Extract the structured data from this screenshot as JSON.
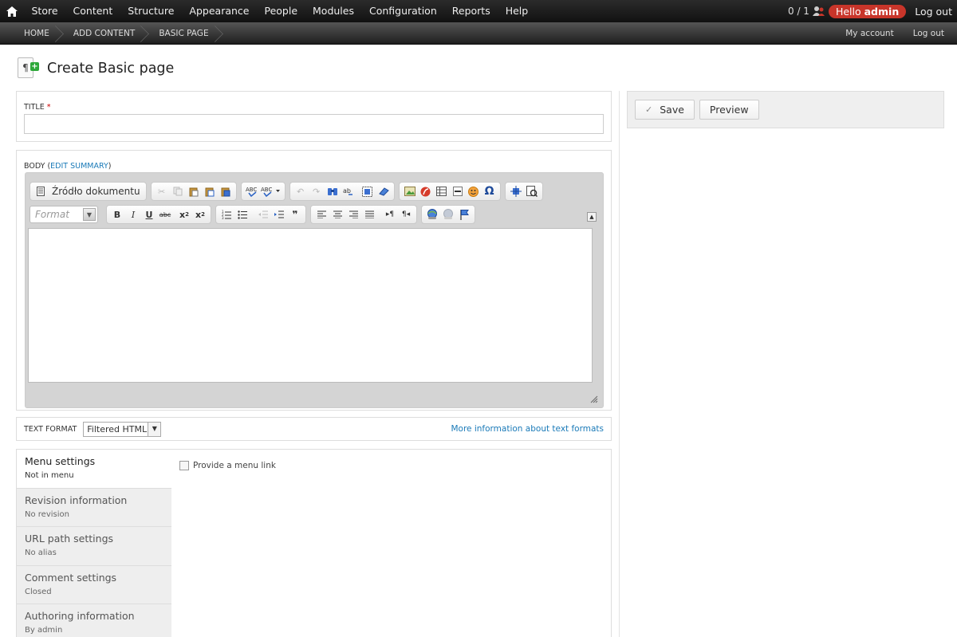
{
  "admin_menu": {
    "items": [
      "Store",
      "Content",
      "Structure",
      "Appearance",
      "People",
      "Modules",
      "Configuration",
      "Reports",
      "Help"
    ],
    "counter": "0 / 1",
    "hello_prefix": "Hello",
    "hello_user": "admin",
    "logout": "Log out"
  },
  "breadcrumb": {
    "items": [
      "HOME",
      "ADD CONTENT",
      "BASIC PAGE"
    ],
    "my_account": "My account",
    "logout": "Log out"
  },
  "page": {
    "title": "Create Basic page",
    "icon_glyph": "¶",
    "icon_plus": "+"
  },
  "title_field": {
    "label": "TITLE",
    "required_mark": "*",
    "value": ""
  },
  "body_field": {
    "label": "BODY",
    "edit_summary_link": "EDIT SUMMARY",
    "source_button": "Źródło dokumentu",
    "format_placeholder": "Format",
    "toolbar_row1": [
      "cut-icon",
      "copy-icon",
      "paste-icon",
      "paste-text-icon",
      "paste-word-icon",
      "spellcheck-icon",
      "spellcheck-options-icon",
      "undo-icon",
      "redo-icon",
      "find-icon",
      "replace-icon",
      "select-all-icon",
      "remove-format-icon",
      "image-icon",
      "flash-icon",
      "table-icon",
      "horizontal-rule-icon",
      "smiley-icon",
      "special-char-icon",
      "maximize-icon",
      "show-blocks-icon"
    ],
    "toolbar_row2": {
      "bold": "B",
      "italic": "I",
      "underline": "U",
      "strike": "abc",
      "subscript": "x",
      "subscript_mark": "2",
      "superscript": "x",
      "superscript_mark": "2",
      "blockquote": "❞",
      "ltr": "▸¶",
      "rtl": "¶◂"
    }
  },
  "text_format": {
    "label": "TEXT FORMAT",
    "selected": "Filtered HTML",
    "help_link": "More information about text formats"
  },
  "vertical_tabs": [
    {
      "title": "Menu settings",
      "summary": "Not in menu"
    },
    {
      "title": "Revision information",
      "summary": "No revision"
    },
    {
      "title": "URL path settings",
      "summary": "No alias"
    },
    {
      "title": "Comment settings",
      "summary": "Closed"
    },
    {
      "title": "Authoring information",
      "summary": "By admin"
    }
  ],
  "menu_pane": {
    "checkbox_label": "Provide a menu link"
  },
  "actions": {
    "save": "Save",
    "preview": "Preview"
  },
  "colors": {
    "admin_bar": "#1c1c1c",
    "hello_badge": "#c8352a",
    "link": "#1a7ab8",
    "required": "#cc0000"
  }
}
